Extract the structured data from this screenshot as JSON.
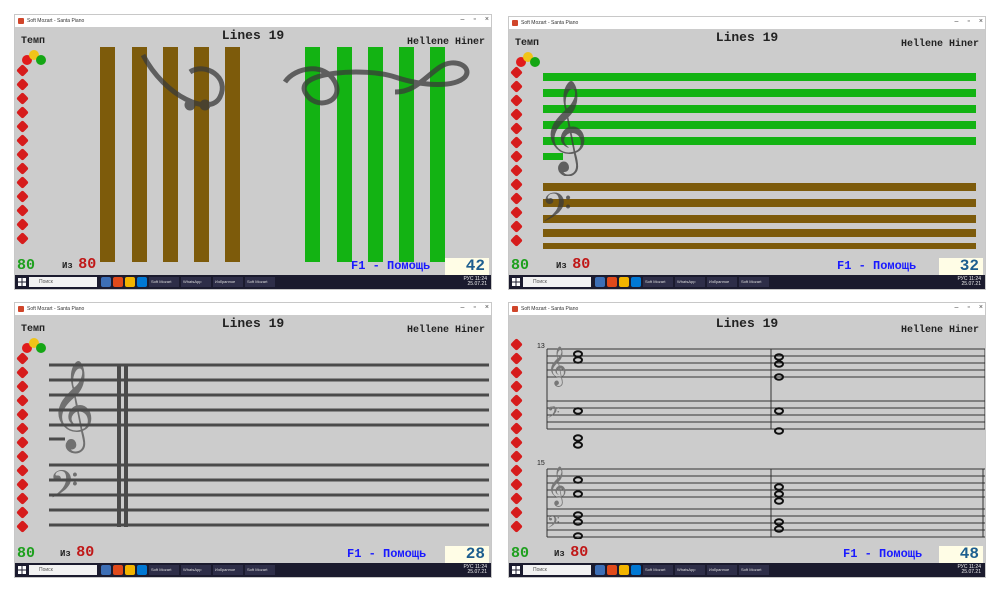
{
  "windows": [
    {
      "title": "Soft Mozart - Santa Piano",
      "lines_title": "Lines 19",
      "player": "Hellene Hiner",
      "tempo_label": "Темп",
      "score": "80",
      "of_label": "Из",
      "of_value": "80",
      "help": "F1 - Помощь",
      "counter": "42"
    },
    {
      "title": "Soft Mozart - Santa Piano",
      "lines_title": "Lines 19",
      "player": "Hellene Hiner",
      "tempo_label": "Темп",
      "score": "80",
      "of_label": "Из",
      "of_value": "80",
      "help": "F1 - Помощь",
      "counter": "32"
    },
    {
      "title": "Soft Mozart - Santa Piano",
      "lines_title": "Lines 19",
      "player": "Hellene Hiner",
      "tempo_label": "Темп",
      "score": "80",
      "of_label": "Из",
      "of_value": "80",
      "help": "F1 - Помощь",
      "counter": "28"
    },
    {
      "title": "Soft Mozart - Santa Piano",
      "lines_title": "Lines 19",
      "player": "Hellene Hiner",
      "tempo_label": "",
      "score": "80",
      "of_label": "Из",
      "of_value": "80",
      "help": "F1 - Помощь",
      "counter": "48",
      "measure_numbers": [
        "13",
        "15"
      ]
    }
  ],
  "taskbar": {
    "search_placeholder": "Поиск",
    "buttons": [
      "Skype",
      "Soft Mozart",
      "WhatsApp",
      "Избранное",
      "Soft Mozart"
    ],
    "tray_lang": "РУС",
    "tray_time": "11:24",
    "tray_date": "25.07.21"
  },
  "colors": {
    "green": "#13b313",
    "brown": "#7d5b0b",
    "staff_gray": "#4a4a4a",
    "stage_bg": "#cccccc"
  }
}
